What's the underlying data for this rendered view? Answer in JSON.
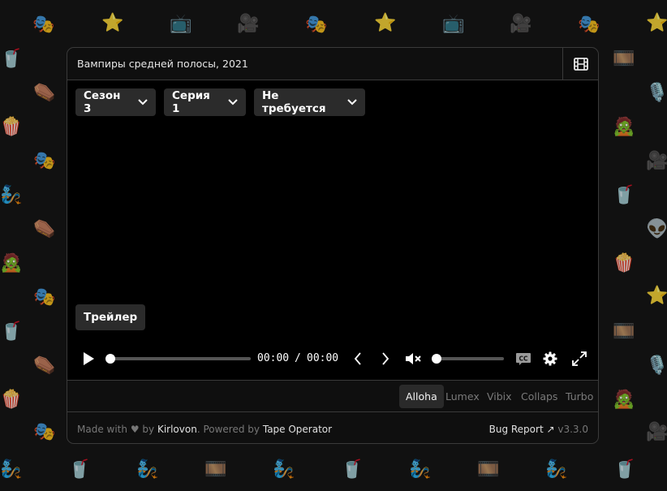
{
  "background": {
    "icons": [
      "theater-mask",
      "star",
      "television",
      "movie-camera",
      "popcorn",
      "popcorn-cup",
      "zombie",
      "coffin",
      "microphone",
      "alien",
      "film-box",
      "genie"
    ]
  },
  "title_bar": {
    "title": "Вампиры средней полосы, 2021",
    "icon": "film-icon"
  },
  "player": {
    "season_select": "Сезон 3",
    "episode_select": "Серия 1",
    "voice_select": "Не требуется",
    "trailer_label": "Трейлер",
    "current_time": "00:00",
    "time_separator": "/",
    "duration": "00:00",
    "progress": 0,
    "volume": 0,
    "muted": true
  },
  "providers": {
    "items": [
      "Alloha",
      "Lumex",
      "Vibix",
      "Collaps",
      "Turbo"
    ],
    "active": "Alloha"
  },
  "footer": {
    "made_with": "Made with",
    "heart": "♥",
    "by": "by",
    "author": "Kirlovon",
    "powered_by": ". Powered by",
    "powered_name": "Tape Operator",
    "bug_report": "Bug Report ↗",
    "version": "v3.3.0"
  },
  "colors": {
    "page_background": "#111111",
    "card_background": "#0f0f0f",
    "player_background": "#000000",
    "control_background": "#2b2b2b",
    "border": "#3a3a3a"
  }
}
